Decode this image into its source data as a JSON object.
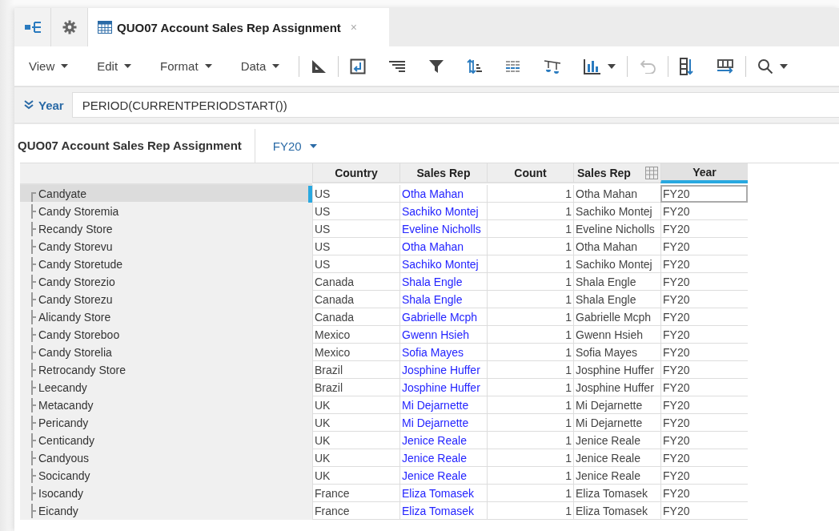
{
  "tabs": [
    {
      "kind": "hierarchy",
      "selected": false
    },
    {
      "kind": "settings",
      "selected": false
    },
    {
      "kind": "sheet",
      "label": "QUO07 Account Sales Rep Assignment",
      "close": "×",
      "selected": true
    }
  ],
  "menus": [
    "View",
    "Edit",
    "Format",
    "Data"
  ],
  "toolbar": [
    {
      "kind": "ruler",
      "disabled": false
    },
    {
      "kind": "pivot",
      "disabled": false
    },
    {
      "kind": "align",
      "disabled": false
    },
    {
      "kind": "filter",
      "disabled": false
    },
    {
      "kind": "sort",
      "disabled": false
    },
    {
      "kind": "grid",
      "disabled": false
    },
    {
      "kind": "balance",
      "disabled": false
    },
    {
      "kind": "chart",
      "disabled": false
    },
    {
      "kind": "undo",
      "disabled": true
    },
    {
      "kind": "columns",
      "disabled": false
    },
    {
      "kind": "freeze",
      "disabled": false
    },
    {
      "kind": "search",
      "disabled": false
    }
  ],
  "filter": {
    "label": "Year",
    "value": "PERIOD(CURRENTPERIODSTART())"
  },
  "sheet": {
    "title": "QUO07 Account Sales Rep Assignment",
    "period": "FY20"
  },
  "table": {
    "columns": [
      {
        "label": "Country",
        "kind": "text",
        "selected": false
      },
      {
        "label": "Sales Rep",
        "kind": "link",
        "selected": false
      },
      {
        "label": "Count",
        "kind": "number",
        "selected": false
      },
      {
        "label": "Sales Rep",
        "kind": "text",
        "selected": false,
        "icon": true
      },
      {
        "label": "Year",
        "kind": "text",
        "selected": true
      }
    ],
    "rows": [
      {
        "name": "Candyate",
        "selected": true,
        "cells": [
          "US",
          "Otha Mahan",
          "1",
          "Otha Mahan",
          "FY20"
        ]
      },
      {
        "name": "Candy Storemia",
        "selected": false,
        "cells": [
          "US",
          "Sachiko Montej",
          "1",
          "Sachiko Montej",
          "FY20"
        ]
      },
      {
        "name": "Recandy Store",
        "selected": false,
        "cells": [
          "US",
          "Eveline Nicholls",
          "1",
          "Eveline Nicholls",
          "FY20"
        ]
      },
      {
        "name": "Candy Storevu",
        "selected": false,
        "cells": [
          "US",
          "Otha Mahan",
          "1",
          "Otha Mahan",
          "FY20"
        ]
      },
      {
        "name": "Candy Storetude",
        "selected": false,
        "cells": [
          "US",
          "Sachiko Montej",
          "1",
          "Sachiko Montej",
          "FY20"
        ]
      },
      {
        "name": "Candy Storezio",
        "selected": false,
        "cells": [
          "Canada",
          "Shala Engle",
          "1",
          "Shala Engle",
          "FY20"
        ]
      },
      {
        "name": "Candy Storezu",
        "selected": false,
        "cells": [
          "Canada",
          "Shala Engle",
          "1",
          "Shala Engle",
          "FY20"
        ]
      },
      {
        "name": "Alicandy Store",
        "selected": false,
        "cells": [
          "Canada",
          "Gabrielle Mcph",
          "1",
          "Gabrielle Mcph",
          "FY20"
        ]
      },
      {
        "name": "Candy Storeboo",
        "selected": false,
        "cells": [
          "Mexico",
          "Gwenn Hsieh",
          "1",
          "Gwenn Hsieh",
          "FY20"
        ]
      },
      {
        "name": "Candy Storelia",
        "selected": false,
        "cells": [
          "Mexico",
          "Sofia Mayes",
          "1",
          "Sofia Mayes",
          "FY20"
        ]
      },
      {
        "name": "Retrocandy Store",
        "selected": false,
        "cells": [
          "Brazil",
          "Josphine Huffer",
          "1",
          "Josphine Huffer",
          "FY20"
        ]
      },
      {
        "name": "Leecandy",
        "selected": false,
        "cells": [
          "Brazil",
          "Josphine Huffer",
          "1",
          "Josphine Huffer",
          "FY20"
        ]
      },
      {
        "name": "Metacandy",
        "selected": false,
        "cells": [
          "UK",
          "Mi Dejarnette",
          "1",
          "Mi Dejarnette",
          "FY20"
        ]
      },
      {
        "name": "Pericandy",
        "selected": false,
        "cells": [
          "UK",
          "Mi Dejarnette",
          "1",
          "Mi Dejarnette",
          "FY20"
        ]
      },
      {
        "name": "Centicandy",
        "selected": false,
        "cells": [
          "UK",
          "Jenice Reale",
          "1",
          "Jenice Reale",
          "FY20"
        ]
      },
      {
        "name": "Candyous",
        "selected": false,
        "cells": [
          "UK",
          "Jenice Reale",
          "1",
          "Jenice Reale",
          "FY20"
        ]
      },
      {
        "name": "Socicandy",
        "selected": false,
        "cells": [
          "UK",
          "Jenice Reale",
          "1",
          "Jenice Reale",
          "FY20"
        ]
      },
      {
        "name": "Isocandy",
        "selected": false,
        "cells": [
          "France",
          "Eliza Tomasek",
          "1",
          "Eliza Tomasek",
          "FY20"
        ]
      },
      {
        "name": "Eicandy",
        "selected": false,
        "cells": [
          "France",
          "Eliza Tomasek",
          "1",
          "Eliza Tomasek",
          "FY20"
        ]
      }
    ]
  }
}
